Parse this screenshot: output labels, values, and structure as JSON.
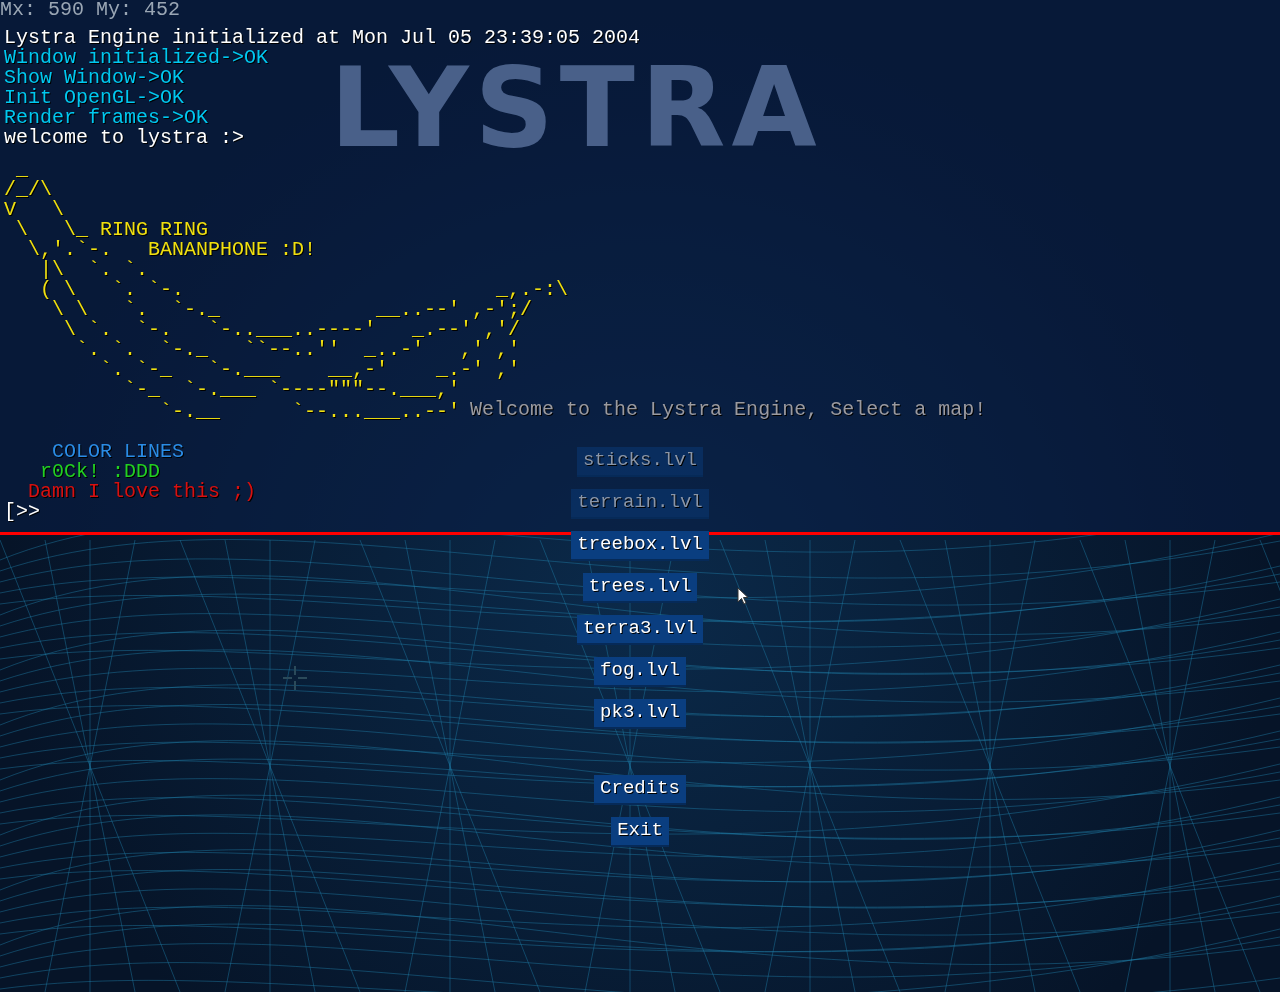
{
  "mouse_readout": "Mx: 590 My: 452",
  "logo": "LYSTRA",
  "console": {
    "log": [
      {
        "text": "Lystra Engine initialized at Mon Jul 05 23:39:05 2004",
        "color": "#ffffff"
      },
      {
        "text": "Window initialized->OK",
        "color": "#00c8f0"
      },
      {
        "text": "Show Window->OK",
        "color": "#00c8f0"
      },
      {
        "text": "Init OpenGL->OK",
        "color": "#00c8f0"
      },
      {
        "text": "Render frames->OK",
        "color": "#00c8f0"
      },
      {
        "text": "welcome to lystra :>",
        "color": "#ffffff"
      }
    ],
    "ascii_art": [
      " _",
      "/_/\\",
      "V   \\",
      " \\   \\_ RING RING",
      "  \\,'.`-.   BANANPHONE :D!",
      "   |\\  `. `.",
      "   ( \\   `. `-.                          _,.-:\\",
      "    \\ \\   `.  `-._             __..--' ,-';/",
      "     \\ `.  `-.   `-..___..----'   _.--' ,'/",
      "      `. `.  `-._   ``--..''  _..-'   ,' ,'",
      "        `. `-_   `-.___    __,-'    _.-' ,'",
      "          `-_  `-.___ `----\"\"\"--.___,'",
      "             `-.__      `--...___..--'"
    ],
    "welcome": "Welcome to the Lystra Engine, Select a map!",
    "color_lines": [
      {
        "text": "    COLOR LINES",
        "color": "#2a8ce6"
      },
      {
        "text": "   r0Ck! :DDD",
        "color": "#22d022"
      },
      {
        "text": "  Damn I love this ;)",
        "color": "#d81010"
      }
    ],
    "prompt": "[>>"
  },
  "maps": [
    {
      "label": "sticks.lvl",
      "dimmed": true
    },
    {
      "label": "terrain.lvl",
      "dimmed": true
    },
    {
      "label": "treebox.lvl",
      "dimmed": false
    },
    {
      "label": "trees.lvl",
      "dimmed": false
    },
    {
      "label": "terra3.lvl",
      "dimmed": false
    },
    {
      "label": "fog.lvl",
      "dimmed": false
    },
    {
      "label": "pk3.lvl",
      "dimmed": false
    }
  ],
  "buttons": [
    "Credits",
    "Exit"
  ]
}
